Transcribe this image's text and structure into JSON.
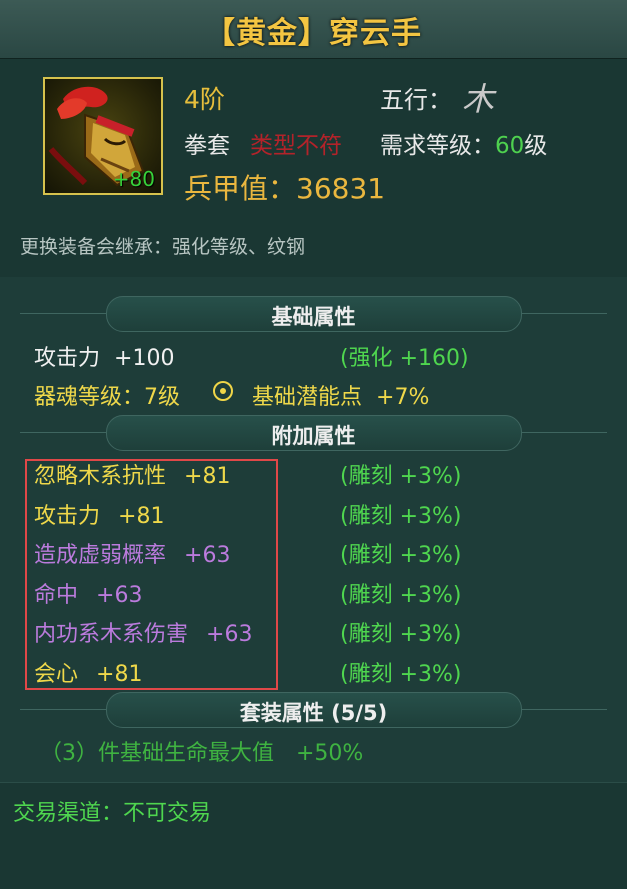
{
  "item": {
    "title": "【黄金】穿云手",
    "plus_level": "+80",
    "rank": "4阶",
    "wuxing_label": "五行：",
    "wuxing_glyph": "木",
    "type": "拳套",
    "type_warning": "类型不符",
    "req_label": "需求等级：",
    "req_value": "60",
    "req_unit": "级",
    "armor_label": "兵甲值：",
    "armor_value": "36831",
    "inherit_note": "更换装备会继承：强化等级、纹钢"
  },
  "basic": {
    "section_title": "基础属性",
    "attack_label": "攻击力",
    "attack_value": "+100",
    "enhance": "(强化 +160)",
    "soul_level": "器魂等级：7级",
    "potential": "基础潜能点",
    "potential_value": "+7%"
  },
  "extra": {
    "section_title": "附加属性",
    "rows": [
      {
        "name": "忽略木系抗性",
        "value": "+81",
        "bonus": "(雕刻 +3%)",
        "color": "#efd84a"
      },
      {
        "name": "攻击力",
        "value": "+81",
        "bonus": "(雕刻 +3%)",
        "color": "#efd84a"
      },
      {
        "name": "造成虚弱概率",
        "value": "+63",
        "bonus": "(雕刻 +3%)",
        "color": "#bb7bdd"
      },
      {
        "name": "命中",
        "value": "+63",
        "bonus": "(雕刻 +3%)",
        "color": "#bb7bdd"
      },
      {
        "name": "内功系木系伤害",
        "value": "+63",
        "bonus": "(雕刻 +3%)",
        "color": "#bb7bdd"
      },
      {
        "name": "会心",
        "value": "+81",
        "bonus": "(雕刻 +3%)",
        "color": "#efd84a"
      }
    ]
  },
  "set": {
    "section_title": "套装属性 (5/5)",
    "bonus": "（3）件基础生命最大值　+50%"
  },
  "trade": {
    "label": "交易渠道：不可交易"
  }
}
